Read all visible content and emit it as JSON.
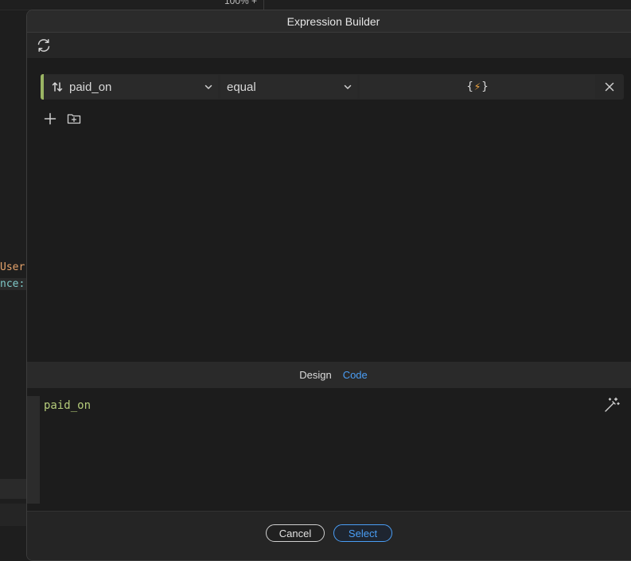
{
  "background": {
    "zoom_text": "100% +",
    "code_line1": "User",
    "code_line2": "nce:"
  },
  "modal": {
    "title": "Expression Builder"
  },
  "toolbar": {
    "refresh_icon": "refresh-icon"
  },
  "condition": {
    "field": "paid_on",
    "operator": "equal",
    "value_icon": "{⚡}",
    "accent_color": "#9bb564"
  },
  "tabs": {
    "design": "Design",
    "code": "Code",
    "active": "Code"
  },
  "editor": {
    "code": "paid_on"
  },
  "footer": {
    "cancel": "Cancel",
    "select": "Select"
  }
}
